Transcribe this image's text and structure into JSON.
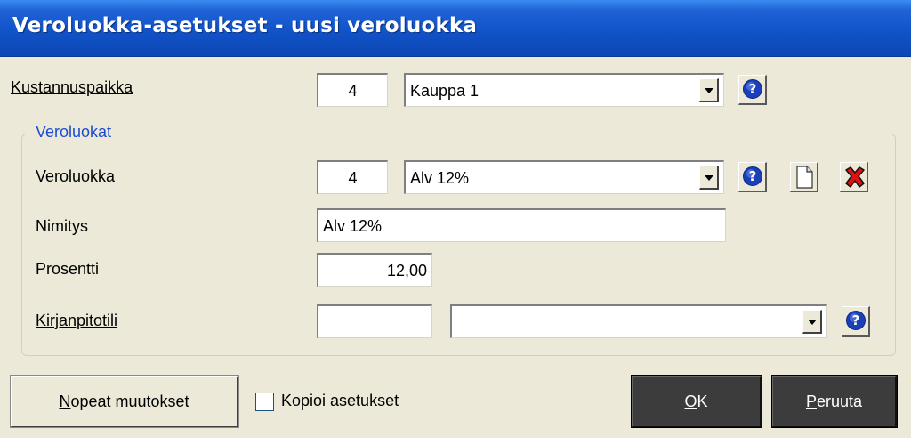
{
  "window": {
    "title": "Veroluokka-asetukset - uusi veroluokka"
  },
  "kustannuspaikka": {
    "label": "Kustannuspaikka",
    "code": "4",
    "name": "Kauppa 1"
  },
  "group": {
    "legend": "Veroluokat"
  },
  "veroluokka": {
    "label": "Veroluokka",
    "code": "4",
    "name": "Alv 12%"
  },
  "nimitys": {
    "label": "Nimitys",
    "value": "Alv 12%"
  },
  "prosentti": {
    "label": "Prosentti",
    "value": "12,00"
  },
  "kirjanpitotili": {
    "label": "Kirjanpitotili",
    "code": "",
    "name": ""
  },
  "buttons": {
    "quick_changes_first": "N",
    "quick_changes_rest": "opeat muutokset",
    "ok_first": "O",
    "ok_rest": "K",
    "cancel_first": "P",
    "cancel_rest": "eruuta"
  },
  "copy_settings": {
    "label": "Kopioi asetukset",
    "checked": false
  },
  "icons": {
    "help": "help-icon",
    "new": "new-document-icon",
    "delete": "delete-icon"
  },
  "colors": {
    "title_bar": "#1153c9",
    "legend": "#1a4bd6",
    "dialog_bg": "#ece9d8"
  }
}
